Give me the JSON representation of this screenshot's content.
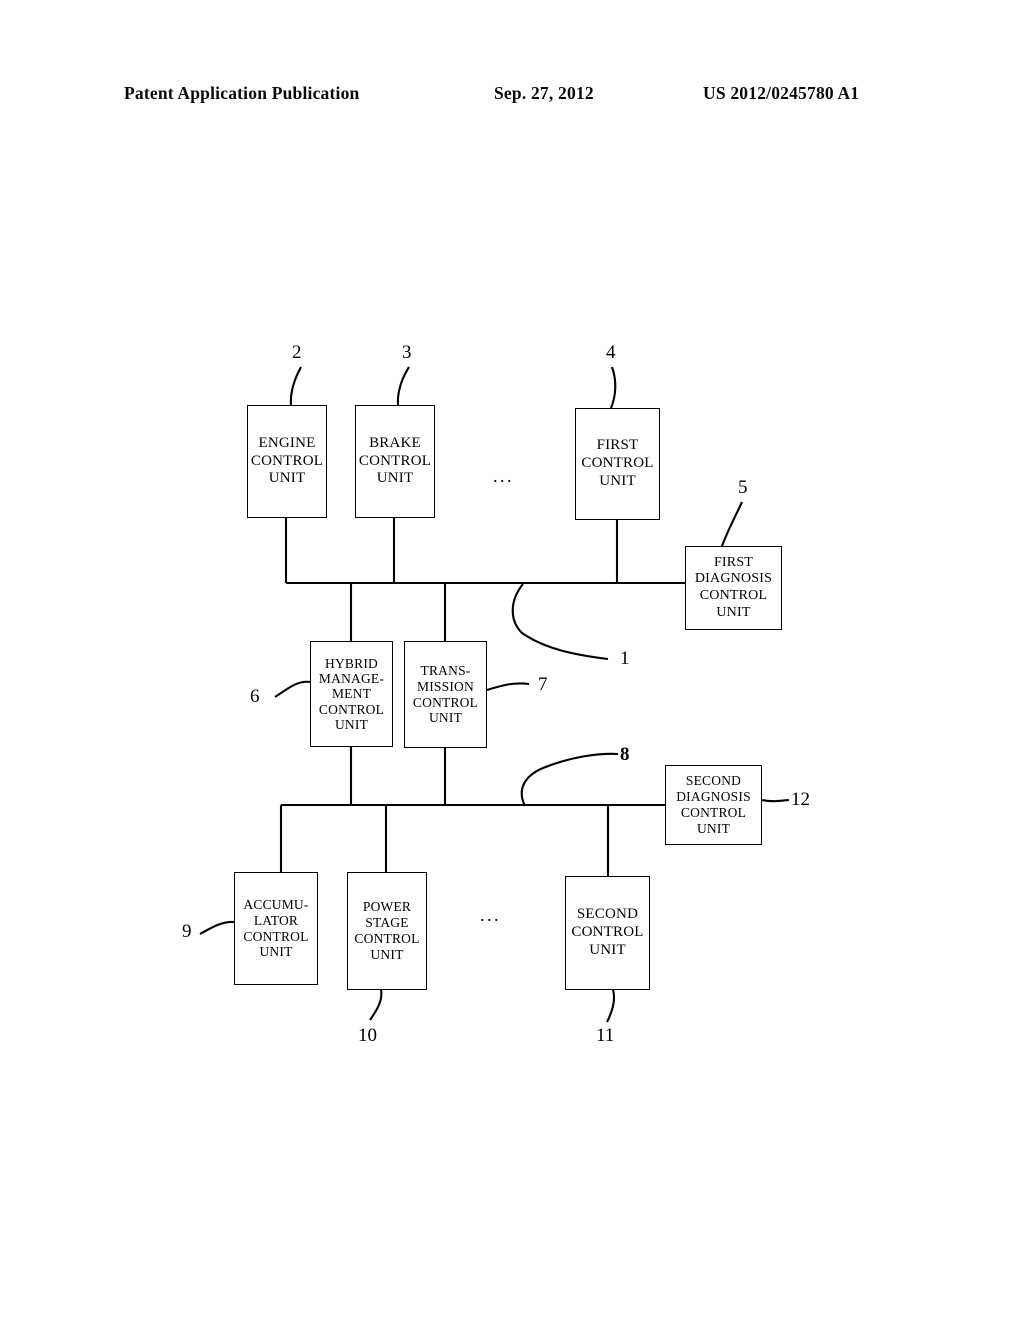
{
  "header": {
    "publication": "Patent Application Publication",
    "date": "Sep. 27, 2012",
    "number": "US 2012/0245780 A1"
  },
  "figure": {
    "ellipsis_top": "...",
    "ellipsis_bottom": "...",
    "blocks": [
      {
        "id": "engine-control-unit",
        "lines": [
          "ENGINE",
          "CONTROL",
          "UNIT"
        ],
        "ref": "2"
      },
      {
        "id": "brake-control-unit",
        "lines": [
          "BRAKE",
          "CONTROL",
          "UNIT"
        ],
        "ref": "3"
      },
      {
        "id": "first-control-unit",
        "lines": [
          "FIRST",
          "CONTROL",
          "UNIT"
        ],
        "ref": "4"
      },
      {
        "id": "first-diagnosis-control-unit",
        "lines": [
          "FIRST",
          "DIAGNOSIS",
          "CONTROL",
          "UNIT"
        ],
        "ref": "5"
      },
      {
        "id": "hybrid-management-control-unit",
        "lines": [
          "HYBRID",
          "MANAGE-",
          "MENT",
          "CONTROL",
          "UNIT"
        ],
        "ref": "6"
      },
      {
        "id": "transmission-control-unit",
        "lines": [
          "TRANS-",
          "MISSION",
          "CONTROL",
          "UNIT"
        ],
        "ref": "7"
      },
      {
        "id": "second-diagnosis-control-unit",
        "lines": [
          "SECOND",
          "DIAGNOSIS",
          "CONTROL",
          "UNIT"
        ],
        "ref": "12"
      },
      {
        "id": "accumulator-control-unit",
        "lines": [
          "ACCUMU-",
          "LATOR",
          "CONTROL",
          "UNIT"
        ],
        "ref": "9"
      },
      {
        "id": "power-stage-control-unit",
        "lines": [
          "POWER",
          "STAGE",
          "CONTROL",
          "UNIT"
        ],
        "ref": "10"
      },
      {
        "id": "second-control-unit",
        "lines": [
          "SECOND",
          "CONTROL",
          "UNIT"
        ],
        "ref": "11"
      }
    ],
    "bus_labels": {
      "upper_bus": "1",
      "lower_bus": "8"
    }
  }
}
